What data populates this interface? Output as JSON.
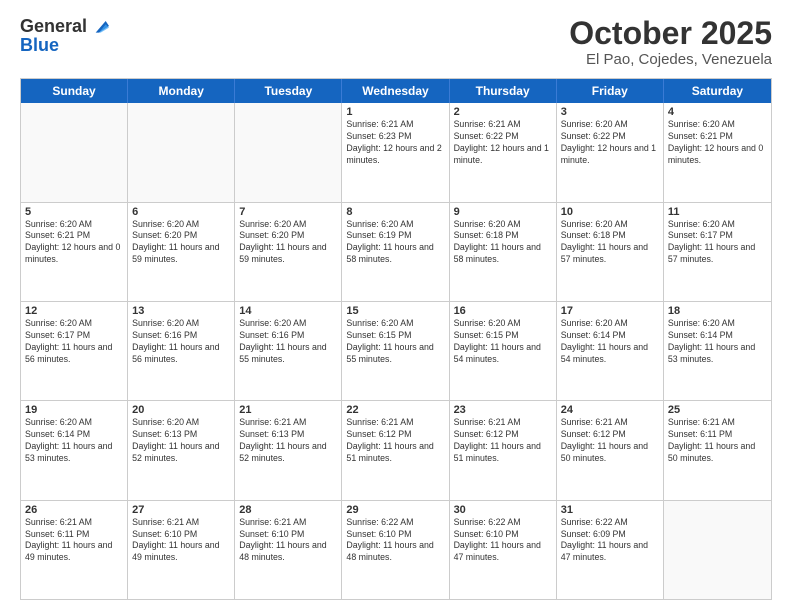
{
  "logo": {
    "general": "General",
    "blue": "Blue"
  },
  "title": {
    "month": "October 2025",
    "location": "El Pao, Cojedes, Venezuela"
  },
  "header_days": [
    "Sunday",
    "Monday",
    "Tuesday",
    "Wednesday",
    "Thursday",
    "Friday",
    "Saturday"
  ],
  "weeks": [
    [
      {
        "day": "",
        "sunrise": "",
        "sunset": "",
        "daylight": ""
      },
      {
        "day": "",
        "sunrise": "",
        "sunset": "",
        "daylight": ""
      },
      {
        "day": "",
        "sunrise": "",
        "sunset": "",
        "daylight": ""
      },
      {
        "day": "1",
        "sunrise": "Sunrise: 6:21 AM",
        "sunset": "Sunset: 6:23 PM",
        "daylight": "Daylight: 12 hours and 2 minutes."
      },
      {
        "day": "2",
        "sunrise": "Sunrise: 6:21 AM",
        "sunset": "Sunset: 6:22 PM",
        "daylight": "Daylight: 12 hours and 1 minute."
      },
      {
        "day": "3",
        "sunrise": "Sunrise: 6:20 AM",
        "sunset": "Sunset: 6:22 PM",
        "daylight": "Daylight: 12 hours and 1 minute."
      },
      {
        "day": "4",
        "sunrise": "Sunrise: 6:20 AM",
        "sunset": "Sunset: 6:21 PM",
        "daylight": "Daylight: 12 hours and 0 minutes."
      }
    ],
    [
      {
        "day": "5",
        "sunrise": "Sunrise: 6:20 AM",
        "sunset": "Sunset: 6:21 PM",
        "daylight": "Daylight: 12 hours and 0 minutes."
      },
      {
        "day": "6",
        "sunrise": "Sunrise: 6:20 AM",
        "sunset": "Sunset: 6:20 PM",
        "daylight": "Daylight: 11 hours and 59 minutes."
      },
      {
        "day": "7",
        "sunrise": "Sunrise: 6:20 AM",
        "sunset": "Sunset: 6:20 PM",
        "daylight": "Daylight: 11 hours and 59 minutes."
      },
      {
        "day": "8",
        "sunrise": "Sunrise: 6:20 AM",
        "sunset": "Sunset: 6:19 PM",
        "daylight": "Daylight: 11 hours and 58 minutes."
      },
      {
        "day": "9",
        "sunrise": "Sunrise: 6:20 AM",
        "sunset": "Sunset: 6:18 PM",
        "daylight": "Daylight: 11 hours and 58 minutes."
      },
      {
        "day": "10",
        "sunrise": "Sunrise: 6:20 AM",
        "sunset": "Sunset: 6:18 PM",
        "daylight": "Daylight: 11 hours and 57 minutes."
      },
      {
        "day": "11",
        "sunrise": "Sunrise: 6:20 AM",
        "sunset": "Sunset: 6:17 PM",
        "daylight": "Daylight: 11 hours and 57 minutes."
      }
    ],
    [
      {
        "day": "12",
        "sunrise": "Sunrise: 6:20 AM",
        "sunset": "Sunset: 6:17 PM",
        "daylight": "Daylight: 11 hours and 56 minutes."
      },
      {
        "day": "13",
        "sunrise": "Sunrise: 6:20 AM",
        "sunset": "Sunset: 6:16 PM",
        "daylight": "Daylight: 11 hours and 56 minutes."
      },
      {
        "day": "14",
        "sunrise": "Sunrise: 6:20 AM",
        "sunset": "Sunset: 6:16 PM",
        "daylight": "Daylight: 11 hours and 55 minutes."
      },
      {
        "day": "15",
        "sunrise": "Sunrise: 6:20 AM",
        "sunset": "Sunset: 6:15 PM",
        "daylight": "Daylight: 11 hours and 55 minutes."
      },
      {
        "day": "16",
        "sunrise": "Sunrise: 6:20 AM",
        "sunset": "Sunset: 6:15 PM",
        "daylight": "Daylight: 11 hours and 54 minutes."
      },
      {
        "day": "17",
        "sunrise": "Sunrise: 6:20 AM",
        "sunset": "Sunset: 6:14 PM",
        "daylight": "Daylight: 11 hours and 54 minutes."
      },
      {
        "day": "18",
        "sunrise": "Sunrise: 6:20 AM",
        "sunset": "Sunset: 6:14 PM",
        "daylight": "Daylight: 11 hours and 53 minutes."
      }
    ],
    [
      {
        "day": "19",
        "sunrise": "Sunrise: 6:20 AM",
        "sunset": "Sunset: 6:14 PM",
        "daylight": "Daylight: 11 hours and 53 minutes."
      },
      {
        "day": "20",
        "sunrise": "Sunrise: 6:20 AM",
        "sunset": "Sunset: 6:13 PM",
        "daylight": "Daylight: 11 hours and 52 minutes."
      },
      {
        "day": "21",
        "sunrise": "Sunrise: 6:21 AM",
        "sunset": "Sunset: 6:13 PM",
        "daylight": "Daylight: 11 hours and 52 minutes."
      },
      {
        "day": "22",
        "sunrise": "Sunrise: 6:21 AM",
        "sunset": "Sunset: 6:12 PM",
        "daylight": "Daylight: 11 hours and 51 minutes."
      },
      {
        "day": "23",
        "sunrise": "Sunrise: 6:21 AM",
        "sunset": "Sunset: 6:12 PM",
        "daylight": "Daylight: 11 hours and 51 minutes."
      },
      {
        "day": "24",
        "sunrise": "Sunrise: 6:21 AM",
        "sunset": "Sunset: 6:12 PM",
        "daylight": "Daylight: 11 hours and 50 minutes."
      },
      {
        "day": "25",
        "sunrise": "Sunrise: 6:21 AM",
        "sunset": "Sunset: 6:11 PM",
        "daylight": "Daylight: 11 hours and 50 minutes."
      }
    ],
    [
      {
        "day": "26",
        "sunrise": "Sunrise: 6:21 AM",
        "sunset": "Sunset: 6:11 PM",
        "daylight": "Daylight: 11 hours and 49 minutes."
      },
      {
        "day": "27",
        "sunrise": "Sunrise: 6:21 AM",
        "sunset": "Sunset: 6:10 PM",
        "daylight": "Daylight: 11 hours and 49 minutes."
      },
      {
        "day": "28",
        "sunrise": "Sunrise: 6:21 AM",
        "sunset": "Sunset: 6:10 PM",
        "daylight": "Daylight: 11 hours and 48 minutes."
      },
      {
        "day": "29",
        "sunrise": "Sunrise: 6:22 AM",
        "sunset": "Sunset: 6:10 PM",
        "daylight": "Daylight: 11 hours and 48 minutes."
      },
      {
        "day": "30",
        "sunrise": "Sunrise: 6:22 AM",
        "sunset": "Sunset: 6:10 PM",
        "daylight": "Daylight: 11 hours and 47 minutes."
      },
      {
        "day": "31",
        "sunrise": "Sunrise: 6:22 AM",
        "sunset": "Sunset: 6:09 PM",
        "daylight": "Daylight: 11 hours and 47 minutes."
      },
      {
        "day": "",
        "sunrise": "",
        "sunset": "",
        "daylight": ""
      }
    ]
  ]
}
